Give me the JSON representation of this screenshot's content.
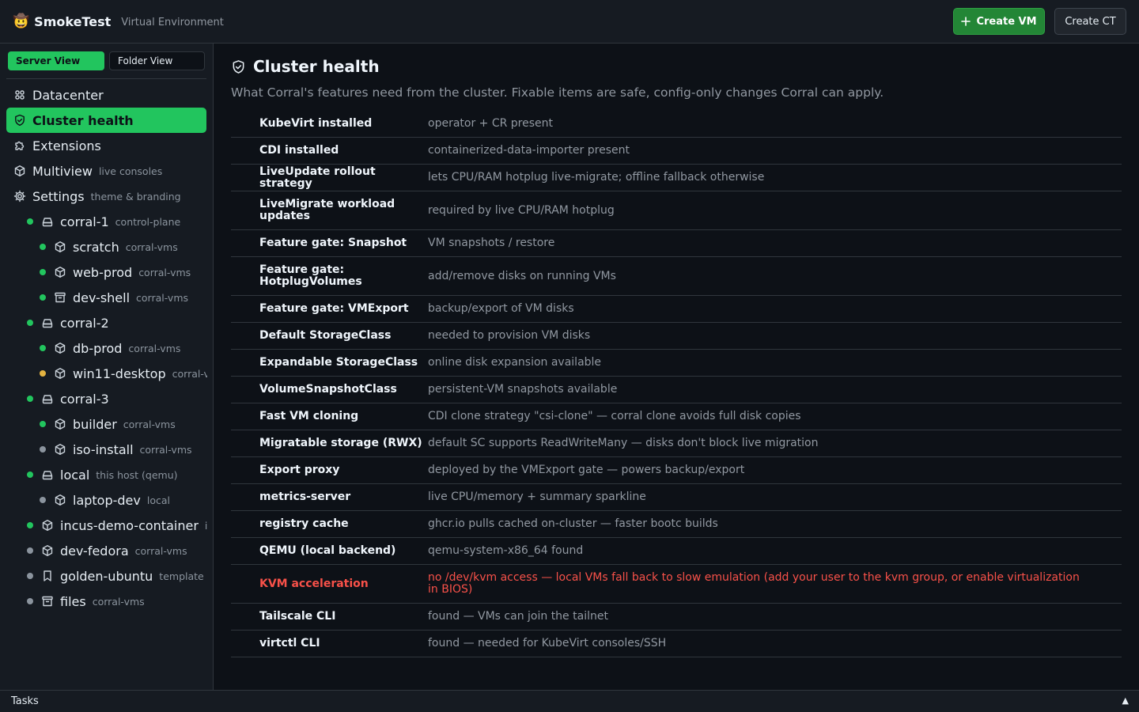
{
  "header": {
    "app_name": "SmokeTest",
    "subtitle": "Virtual Environment",
    "create_vm_label": "Create VM",
    "create_ct_label": "Create CT"
  },
  "sidebar": {
    "view_toggle": {
      "server": "Server View",
      "folder": "Folder View",
      "active": "Server View"
    },
    "items": [
      {
        "label": "Datacenter",
        "sub": "",
        "icon": "grid-icon",
        "status": null,
        "depth": 0,
        "active": false
      },
      {
        "label": "Cluster health",
        "sub": "",
        "icon": "shield-check-icon",
        "status": null,
        "depth": 0,
        "active": true
      },
      {
        "label": "Extensions",
        "sub": "",
        "icon": "puzzle-icon",
        "status": null,
        "depth": 0,
        "active": false
      },
      {
        "label": "Multiview",
        "sub": "live consoles",
        "icon": "cube-icon",
        "status": null,
        "depth": 0,
        "active": false
      },
      {
        "label": "Settings",
        "sub": "theme & branding",
        "icon": "gear-icon",
        "status": null,
        "depth": 0,
        "active": false
      },
      {
        "label": "corral-1",
        "sub": "control-plane",
        "icon": "server-icon",
        "status": "running",
        "depth": 1,
        "active": false
      },
      {
        "label": "scratch",
        "sub": "corral-vms",
        "icon": "cube-icon",
        "status": "running",
        "depth": 2,
        "active": false
      },
      {
        "label": "web-prod",
        "sub": "corral-vms",
        "icon": "cube-icon",
        "status": "running",
        "depth": 2,
        "active": false
      },
      {
        "label": "dev-shell",
        "sub": "corral-vms",
        "icon": "archive-icon",
        "status": "running",
        "depth": 2,
        "active": false
      },
      {
        "label": "corral-2",
        "sub": "",
        "icon": "server-icon",
        "status": "running",
        "depth": 1,
        "active": false
      },
      {
        "label": "db-prod",
        "sub": "corral-vms",
        "icon": "cube-icon",
        "status": "running",
        "depth": 2,
        "active": false
      },
      {
        "label": "win11-desktop",
        "sub": "corral-vms",
        "icon": "cube-icon",
        "status": "warning",
        "depth": 2,
        "active": false
      },
      {
        "label": "corral-3",
        "sub": "",
        "icon": "server-icon",
        "status": "running",
        "depth": 1,
        "active": false
      },
      {
        "label": "builder",
        "sub": "corral-vms",
        "icon": "cube-icon",
        "status": "running",
        "depth": 2,
        "active": false
      },
      {
        "label": "iso-install",
        "sub": "corral-vms",
        "icon": "cube-icon",
        "status": "stopped",
        "depth": 2,
        "active": false
      },
      {
        "label": "local",
        "sub": "this host (qemu)",
        "icon": "server-icon",
        "status": "running",
        "depth": 1,
        "active": false
      },
      {
        "label": "laptop-dev",
        "sub": "local",
        "icon": "cube-icon",
        "status": "stopped",
        "depth": 2,
        "active": false
      },
      {
        "label": "incus-demo-container",
        "sub": "incus",
        "icon": "cube-icon",
        "status": "running",
        "depth": 1,
        "active": false
      },
      {
        "label": "dev-fedora",
        "sub": "corral-vms",
        "icon": "cube-icon",
        "status": "stopped",
        "depth": 1,
        "active": false
      },
      {
        "label": "golden-ubuntu",
        "sub": "template",
        "icon": "bookmark-icon",
        "status": "stopped",
        "depth": 1,
        "active": false
      },
      {
        "label": "files",
        "sub": "corral-vms",
        "icon": "archive-icon",
        "status": "stopped",
        "depth": 1,
        "active": false
      }
    ]
  },
  "main": {
    "title": "Cluster health",
    "description": "What Corral's features need from the cluster. Fixable items are safe, config-only changes Corral can apply.",
    "checks": [
      {
        "name": "KubeVirt installed",
        "detail": "operator + CR present",
        "ok": true
      },
      {
        "name": "CDI installed",
        "detail": "containerized-data-importer present",
        "ok": true
      },
      {
        "name": "LiveUpdate rollout strategy",
        "detail": "lets CPU/RAM hotplug live-migrate; offline fallback otherwise",
        "ok": true
      },
      {
        "name": "LiveMigrate workload updates",
        "detail": "required by live CPU/RAM hotplug",
        "ok": true
      },
      {
        "name": "Feature gate: Snapshot",
        "detail": "VM snapshots / restore",
        "ok": true
      },
      {
        "name": "Feature gate: HotplugVolumes",
        "detail": "add/remove disks on running VMs",
        "ok": true
      },
      {
        "name": "Feature gate: VMExport",
        "detail": "backup/export of VM disks",
        "ok": true
      },
      {
        "name": "Default StorageClass",
        "detail": "needed to provision VM disks",
        "ok": true
      },
      {
        "name": "Expandable StorageClass",
        "detail": "online disk expansion available",
        "ok": true
      },
      {
        "name": "VolumeSnapshotClass",
        "detail": "persistent-VM snapshots available",
        "ok": true
      },
      {
        "name": "Fast VM cloning",
        "detail": "CDI clone strategy \"csi-clone\" — corral clone avoids full disk copies",
        "ok": true
      },
      {
        "name": "Migratable storage (RWX)",
        "detail": "default SC supports ReadWriteMany — disks don't block live migration",
        "ok": true
      },
      {
        "name": "Export proxy",
        "detail": "deployed by the VMExport gate — powers backup/export",
        "ok": true
      },
      {
        "name": "metrics-server",
        "detail": "live CPU/memory + summary sparkline",
        "ok": true
      },
      {
        "name": "registry cache",
        "detail": "ghcr.io pulls cached on-cluster — faster bootc builds",
        "ok": true
      },
      {
        "name": "QEMU (local backend)",
        "detail": "qemu-system-x86_64 found",
        "ok": true
      },
      {
        "name": "KVM acceleration",
        "detail": "no /dev/kvm access — local VMs fall back to slow emulation (add your user to the kvm group, or enable virtualization in BIOS)",
        "ok": false
      },
      {
        "name": "Tailscale CLI",
        "detail": "found — VMs can join the tailnet",
        "ok": true
      },
      {
        "name": "virtctl CLI",
        "detail": "found — needed for KubeVirt consoles/SSH",
        "ok": true
      }
    ]
  },
  "footer": {
    "label": "Tasks",
    "toggle": "▲"
  },
  "colors": {
    "accent": "#22c55e",
    "running": "#22c55e",
    "warning": "#e3b341",
    "stopped": "#8b949e",
    "error": "#f85149"
  }
}
